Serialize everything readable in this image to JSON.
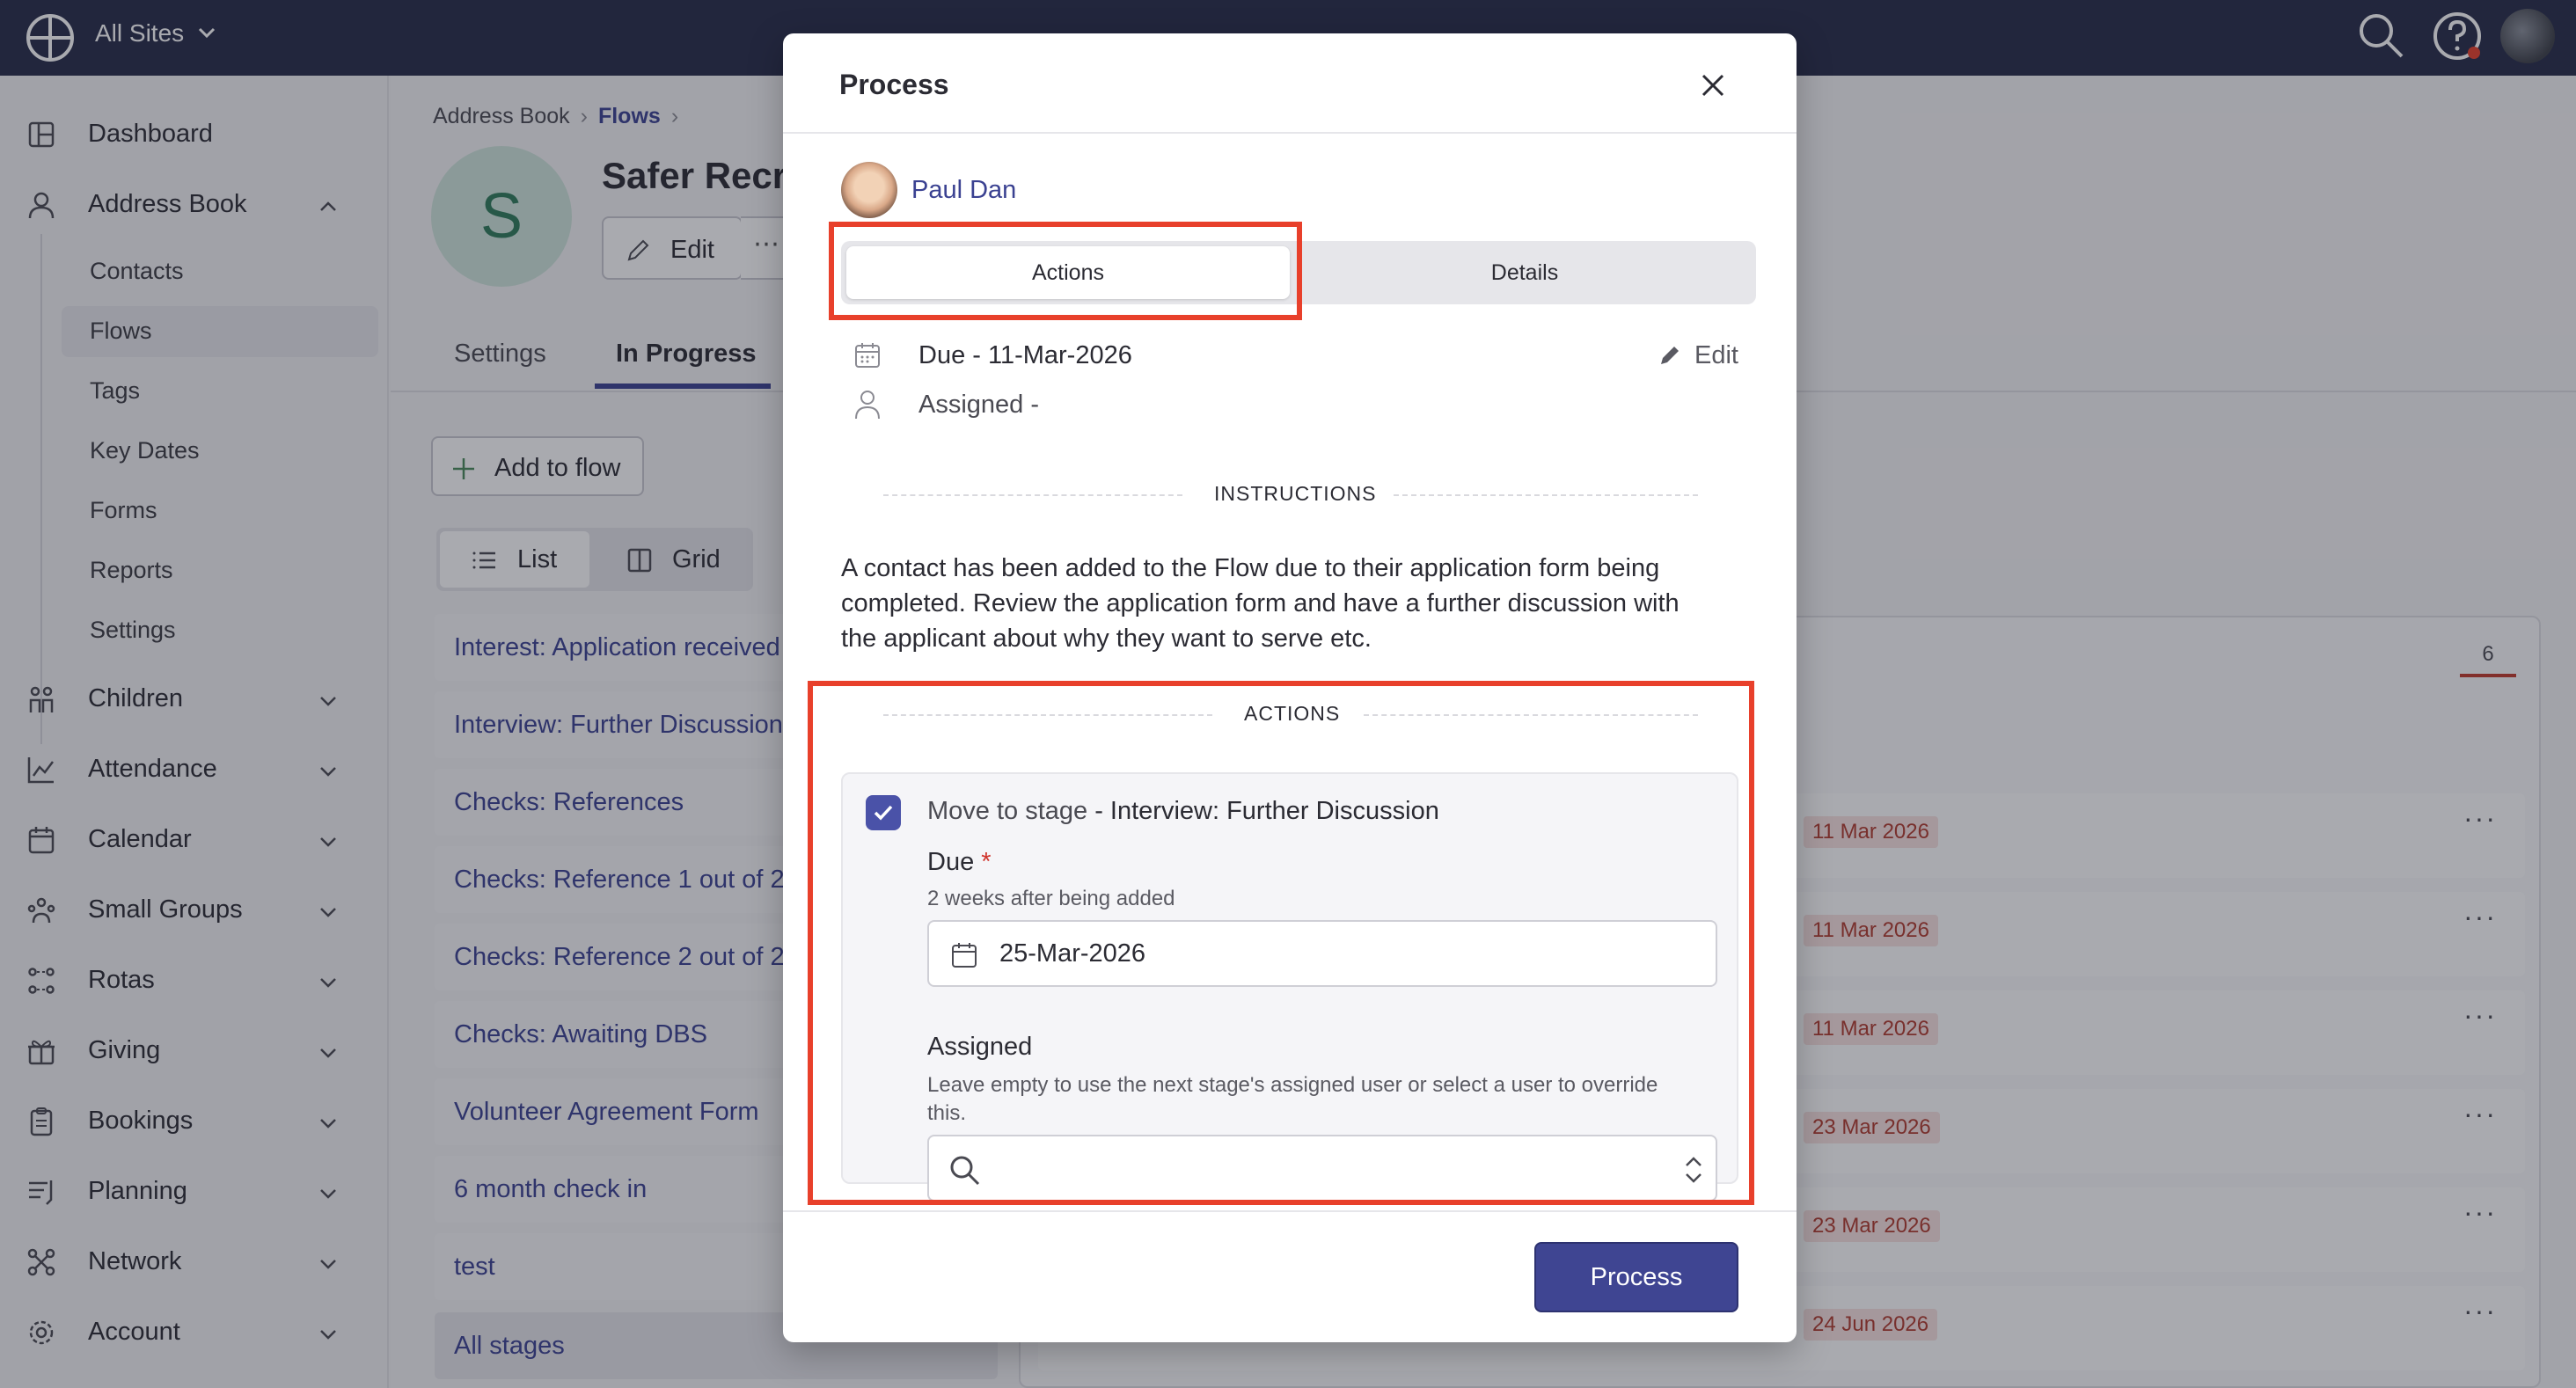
{
  "topbar": {
    "site_switcher": "All Sites",
    "icons": [
      "globe-icon",
      "chevron-down-icon",
      "search-icon",
      "help-icon",
      "user-avatar"
    ]
  },
  "sidebar": {
    "items": [
      {
        "label": "Dashboard",
        "icon": "dashboard-icon"
      },
      {
        "label": "Address Book",
        "icon": "person-icon",
        "expanded": true
      },
      {
        "label": "Children",
        "icon": "children-icon"
      },
      {
        "label": "Attendance",
        "icon": "chart-icon"
      },
      {
        "label": "Calendar",
        "icon": "calendar-icon"
      },
      {
        "label": "Small Groups",
        "icon": "groups-icon"
      },
      {
        "label": "Rotas",
        "icon": "rotas-icon"
      },
      {
        "label": "Giving",
        "icon": "gift-icon"
      },
      {
        "label": "Bookings",
        "icon": "clipboard-icon"
      },
      {
        "label": "Planning",
        "icon": "planning-icon"
      },
      {
        "label": "Network",
        "icon": "network-icon"
      },
      {
        "label": "Account",
        "icon": "gear-icon"
      }
    ],
    "sub_items": [
      "Contacts",
      "Flows",
      "Tags",
      "Key Dates",
      "Forms",
      "Reports",
      "Settings"
    ],
    "active_sub_item": "Flows"
  },
  "background": {
    "breadcrumb": [
      "Address Book",
      "Flows"
    ],
    "flow_avatar_letter": "S",
    "flow_title": "Safer Recru",
    "edit_label": "Edit",
    "more_label": "⋯",
    "tabs": [
      "Settings",
      "In Progress"
    ],
    "add_to_flow_label": "Add to flow",
    "view_options": [
      "List",
      "Grid"
    ],
    "stages": [
      "Interest: Application received",
      "Interview: Further Discussion",
      "Checks: References",
      "Checks: Reference 1 out of 2",
      "Checks: Reference 2 out of 2",
      "Checks: Awaiting DBS",
      "Volunteer Agreement Form",
      "6 month check in",
      "test",
      "All stages"
    ],
    "count_badge": "6",
    "row_dates": [
      "11 Mar 2026",
      "11 Mar 2026",
      "11 Mar 2026",
      "23 Mar 2026",
      "23 Mar 2026",
      "24 Jun 2026"
    ],
    "row_more": "···"
  },
  "modal": {
    "title": "Process",
    "user_name": "Paul Dan",
    "tabs": {
      "actions": "Actions",
      "details": "Details"
    },
    "due_text": "Due - 11-Mar-2026",
    "edit_label": "Edit",
    "assigned_text": "Assigned -",
    "instructions_heading": "INSTRUCTIONS",
    "instructions_body": "A contact has been added to the Flow due to their application form being completed. Review the application form and have a further discussion with the applicant about why they want to serve etc.",
    "actions_heading": "ACTIONS",
    "action": {
      "checked": true,
      "move_prefix": "Move to stage",
      "move_stage": "- Interview: Further Discussion",
      "due_label": "Due",
      "required_mark": "*",
      "due_help": "2 weeks after being added",
      "due_value": "25-Mar-2026",
      "assigned_label": "Assigned",
      "assigned_help": "Leave empty to use the next stage's assigned user or select a user to override this.",
      "assigned_value": ""
    },
    "process_button": "Process"
  },
  "colors": {
    "topbar": "#262a47",
    "accent": "#3f4592",
    "link": "#3a4191",
    "highlight": "#e8402b",
    "date_pill_bg": "#f9e2e0",
    "date_pill_text": "#b03a2e"
  }
}
